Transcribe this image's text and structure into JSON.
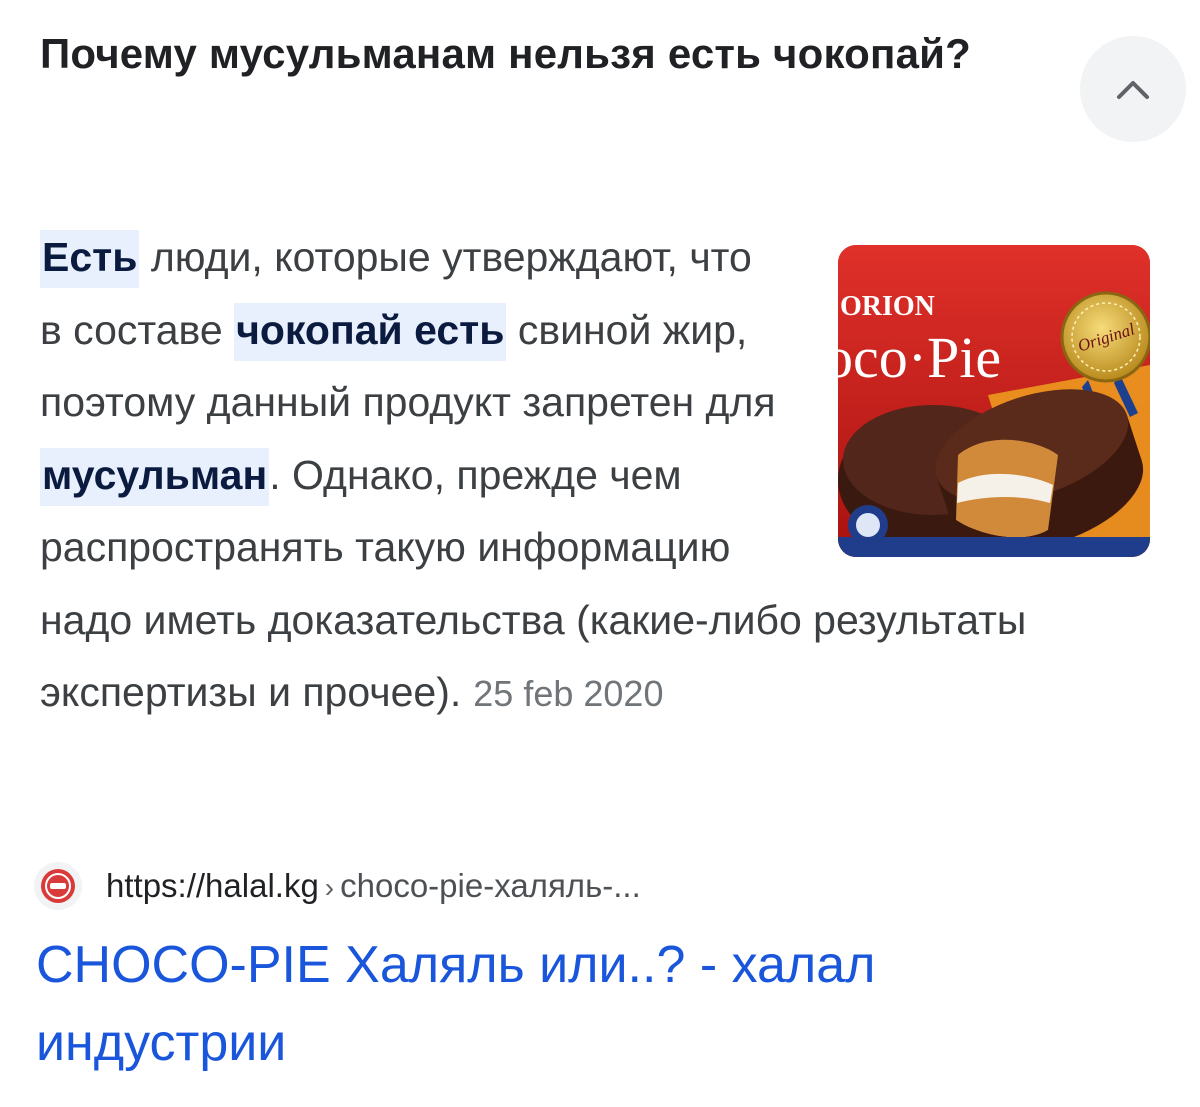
{
  "question": "Почему мусульманам нельзя есть чокопай?",
  "collapse_icon": "chevron-up-icon",
  "snippet": {
    "hl_1": "Есть",
    "text_1": " люди, которые утверждают, что в составе ",
    "hl_2": "чокопай есть",
    "text_2": " свиной жир, поэтому данный продукт запретен для ",
    "hl_3": "мусульман",
    "text_3": ". Однако, прежде чем распространять такую информацию надо иметь доказательства (какие-либо результаты экспертизы и прочее).",
    "date": "25 feb 2020"
  },
  "thumbnail": {
    "brand_small": "ORION",
    "brand_large": "oco·Pie",
    "seal": "Original"
  },
  "source": {
    "favicon_icon": "halal-logo-icon",
    "url": "https://halal.kg",
    "separator": "›",
    "path": "choco-pie-халяль-..."
  },
  "result_title": "CHOCO-PIE Халяль или..? - халал индустрии",
  "colors": {
    "link": "#1a56db",
    "highlight": "#e8f0fe",
    "button_bg": "#f1f3f4"
  }
}
